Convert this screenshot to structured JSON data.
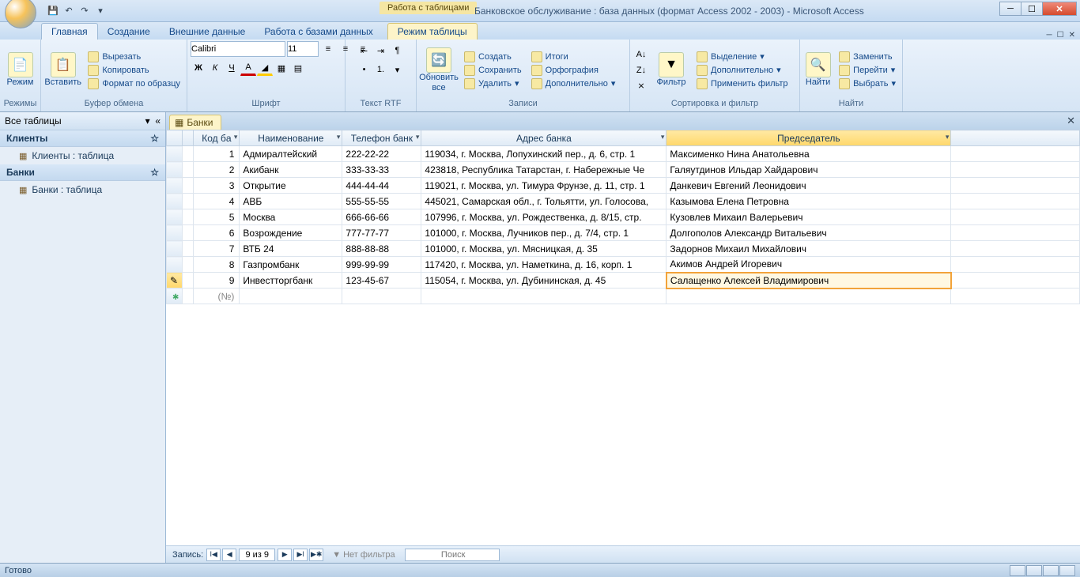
{
  "titlebar": {
    "contextual_label": "Работа с таблицами",
    "title": "Банковское обслуживание : база данных (формат Access 2002 - 2003) - Microsoft Access"
  },
  "ribbon_tabs": {
    "items": [
      "Главная",
      "Создание",
      "Внешние данные",
      "Работа с базами данных"
    ],
    "contextual": "Режим таблицы"
  },
  "ribbon": {
    "rezhimy": {
      "label": "Режимы",
      "btn": "Режим"
    },
    "clipboard": {
      "label": "Буфер обмена",
      "paste": "Вставить",
      "cut": "Вырезать",
      "copy": "Копировать",
      "format_painter": "Формат по образцу"
    },
    "font": {
      "label": "Шрифт",
      "name": "Calibri",
      "size": "11"
    },
    "rtf": {
      "label": "Текст RTF"
    },
    "records": {
      "label": "Записи",
      "refresh": "Обновить все",
      "create": "Создать",
      "save": "Сохранить",
      "delete": "Удалить",
      "totals": "Итоги",
      "spelling": "Орфография",
      "more": "Дополнительно"
    },
    "sort_filter": {
      "label": "Сортировка и фильтр",
      "filter": "Фильтр",
      "selection": "Выделение",
      "advanced": "Дополнительно",
      "toggle": "Применить фильтр"
    },
    "find": {
      "label": "Найти",
      "find": "Найти",
      "replace": "Заменить",
      "goto": "Перейти",
      "select": "Выбрать"
    }
  },
  "nav": {
    "header": "Все таблицы",
    "groups": [
      {
        "title": "Клиенты",
        "items": [
          "Клиенты : таблица"
        ]
      },
      {
        "title": "Банки",
        "items": [
          "Банки : таблица"
        ]
      }
    ]
  },
  "doc_tab": "Банки",
  "columns": [
    "Код бa",
    "Наименование",
    "Телефон банк",
    "Адрес банка",
    "Председатель"
  ],
  "rows": [
    {
      "code": "1",
      "name": "Адмиралтейский",
      "phone": "222-22-22",
      "address": "119034, г. Москва, Лопухинский пер., д. 6, стр. 1",
      "chair": "Максименко Нина Анатольевна"
    },
    {
      "code": "2",
      "name": "Акибанк",
      "phone": "333-33-33",
      "address": "423818, Республика Татарстан, г. Набережные Че",
      "chair": "Галяутдинов Ильдар Хайдарович"
    },
    {
      "code": "3",
      "name": "Открытие",
      "phone": "444-44-44",
      "address": "119021, г. Москва, ул. Тимура Фрунзе, д. 11, стр. 1",
      "chair": "Данкевич Евгений Леонидович"
    },
    {
      "code": "4",
      "name": "АВБ",
      "phone": "555-55-55",
      "address": "445021, Самарская обл., г. Тольятти, ул. Голосова,",
      "chair": "Казымова Елена Петровна"
    },
    {
      "code": "5",
      "name": "Москва",
      "phone": "666-66-66",
      "address": "107996, г. Москва, ул. Рождественка, д. 8/15, стр.",
      "chair": "Кузовлев Михаил Валерьевич"
    },
    {
      "code": "6",
      "name": "Возрождение",
      "phone": "777-77-77",
      "address": "101000, г. Москва, Лучников пер., д. 7/4, стр. 1",
      "chair": "Долгополов Александр Витальевич"
    },
    {
      "code": "7",
      "name": "ВТБ 24",
      "phone": "888-88-88",
      "address": "101000, г. Москва, ул. Мясницкая, д. 35",
      "chair": "Задорнов Михаил Михайлович"
    },
    {
      "code": "8",
      "name": "Газпромбанк",
      "phone": "999-99-99",
      "address": "117420, г. Москва, ул. Наметкина, д. 16, корп. 1",
      "chair": "Акимов Андрей Игоревич"
    },
    {
      "code": "9",
      "name": "Инвестторгбанк",
      "phone": "123-45-67",
      "address": "115054, г. Москва, ул. Дубининская, д. 45",
      "chair": "Салащенко Алексей Владимирович"
    }
  ],
  "new_row_placeholder": "(№)",
  "recnav": {
    "label": "Запись:",
    "position": "9 из 9",
    "no_filter": "Нет фильтра",
    "search": "Поиск"
  },
  "status": "Готово"
}
